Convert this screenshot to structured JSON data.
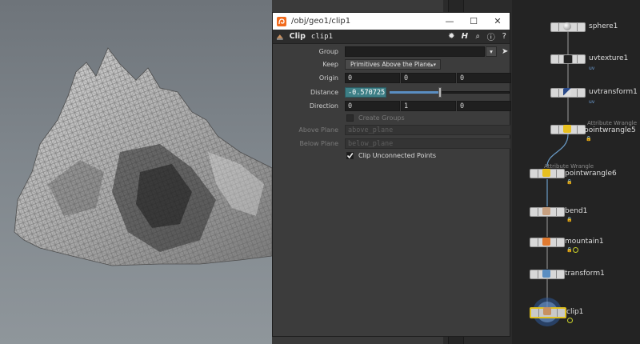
{
  "window": {
    "path_title": "/obj/geo1/clip1",
    "minimize": "—",
    "maximize": "☐",
    "close": "✕"
  },
  "toolbar": {
    "node_type": "Clip",
    "node_name": "clip1"
  },
  "params": {
    "group": {
      "label": "Group",
      "value": ""
    },
    "keep": {
      "label": "Keep",
      "value": "Primitives Above the Plane"
    },
    "origin": {
      "label": "Origin",
      "values": [
        "0",
        "0",
        "0"
      ]
    },
    "distance": {
      "label": "Distance",
      "value": "-0.570725",
      "slider_fraction": 0.42
    },
    "direction": {
      "label": "Direction",
      "values": [
        "0",
        "1",
        "0"
      ]
    },
    "create_groups": {
      "label": "Create Groups",
      "checked": false
    },
    "above_plane": {
      "label": "Above Plane",
      "value": "above_plane"
    },
    "below_plane": {
      "label": "Below Plane",
      "value": "below_plane"
    },
    "clip_unconnected": {
      "label": "Clip Unconnected Points",
      "checked": true
    }
  },
  "network": {
    "nodes": [
      {
        "name": "sphere1",
        "type": "",
        "sub": ""
      },
      {
        "name": "uvtexture1",
        "type": "",
        "sub": "uv"
      },
      {
        "name": "uvtransform1",
        "type": "",
        "sub": "uv"
      },
      {
        "name": "pointwrangle5",
        "type": "Attribute Wrangle",
        "sub": ""
      },
      {
        "name": "pointwrangle6",
        "type": "Attribute Wrangle",
        "sub": ""
      },
      {
        "name": "bend1",
        "type": "",
        "sub": ""
      },
      {
        "name": "mountain1",
        "type": "",
        "sub": ""
      },
      {
        "name": "transform1",
        "type": "",
        "sub": ""
      },
      {
        "name": "clip1",
        "type": "",
        "sub": ""
      }
    ]
  },
  "colors": {
    "accent_teal": "#3d7f86",
    "display_flag": "#e0c020",
    "wire": "#6a9cc8"
  }
}
